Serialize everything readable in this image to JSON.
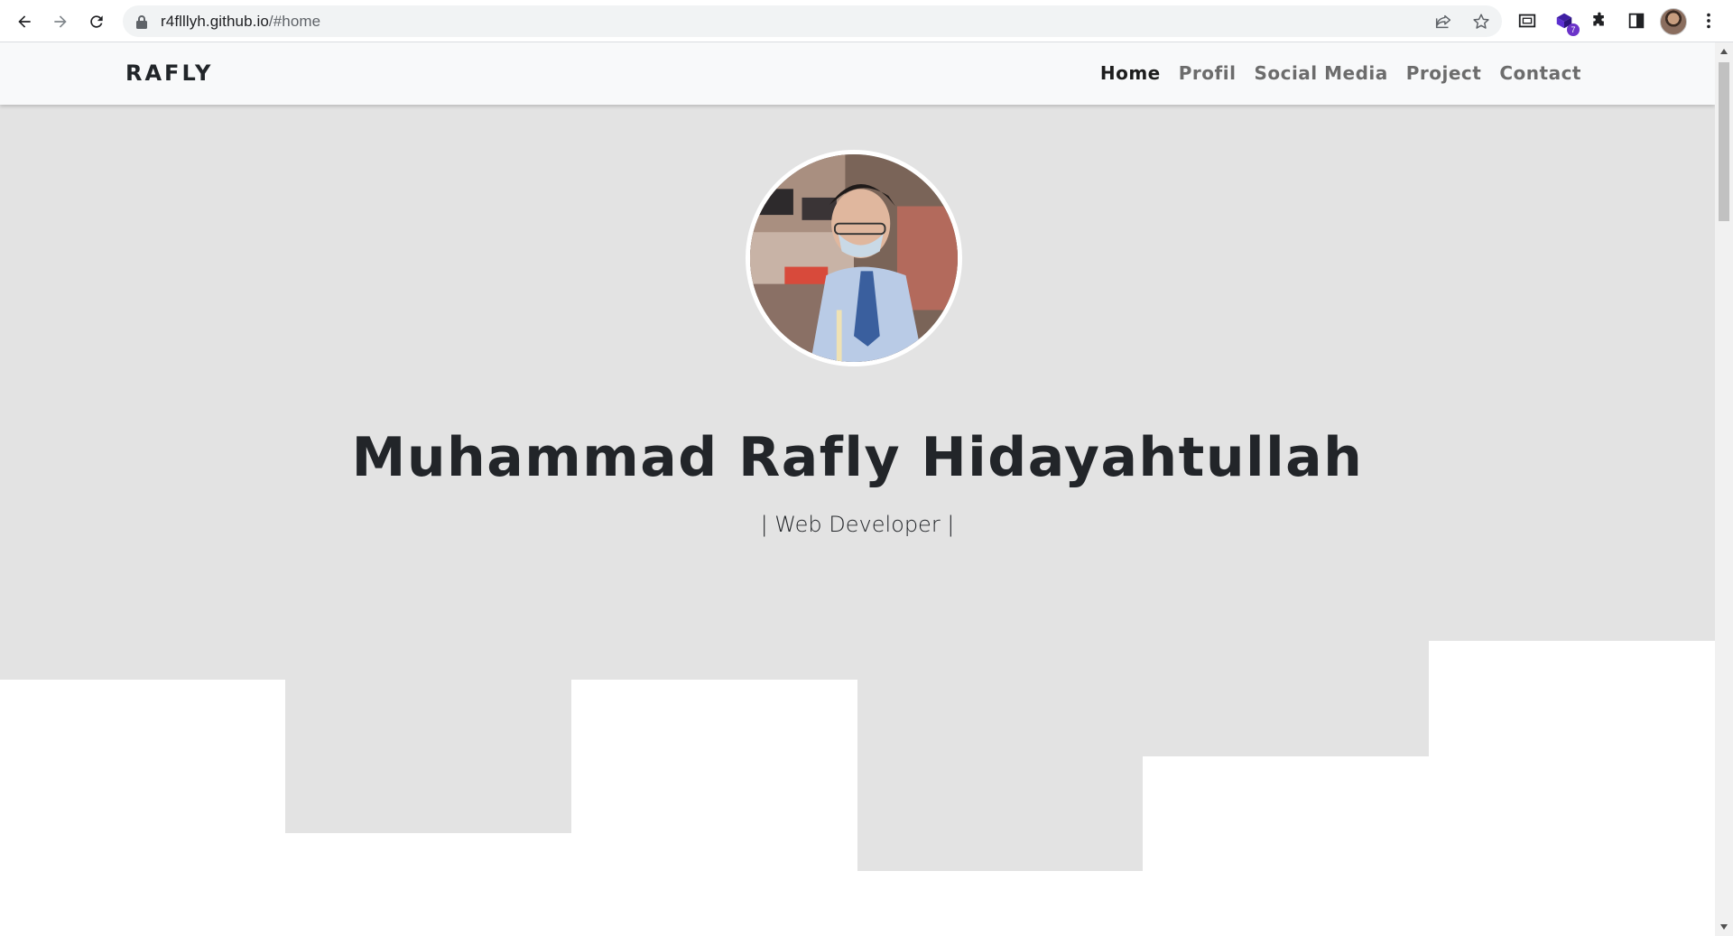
{
  "browser": {
    "url_host": "r4flllyh.github.io",
    "url_path": "/#home",
    "extension_badge": "7"
  },
  "navbar": {
    "brand": "RAFLY",
    "menu": [
      {
        "label": "Home",
        "active": true
      },
      {
        "label": "Profil",
        "active": false
      },
      {
        "label": "Social Media",
        "active": false
      },
      {
        "label": "Project",
        "active": false
      },
      {
        "label": "Contact",
        "active": false
      }
    ]
  },
  "hero": {
    "name": "Muhammad Rafly Hidayahtullah",
    "subtitle": "| Web Developer |"
  },
  "colors": {
    "hero_bg": "#e3e3e3",
    "navbar_bg": "#f8f9fa",
    "text": "#212529"
  }
}
